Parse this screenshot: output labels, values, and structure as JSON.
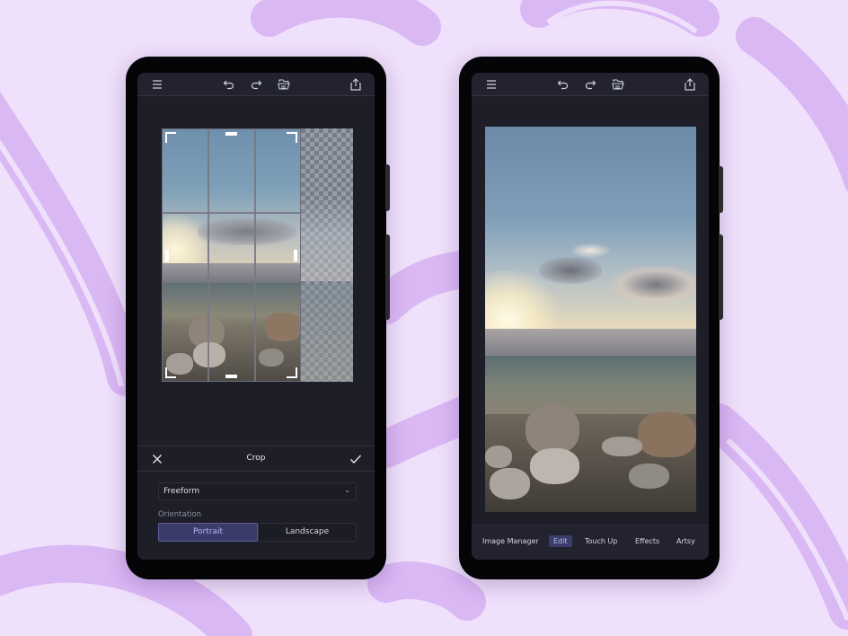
{
  "colors": {
    "background": "#efe0fb",
    "swirl": "#dab8f4",
    "phone_body": "#050507",
    "screen_bg": "#1d1e28",
    "toolbar_bg": "#22232e",
    "accent": "#3b3c6b",
    "accent_text": "#b5b8ee"
  },
  "left_phone": {
    "toolbar": {
      "icons": [
        "menu-icon",
        "undo-icon",
        "redo-icon",
        "open-folder-icon",
        "share-icon"
      ]
    },
    "crop_panel": {
      "title": "Crop",
      "cancel_icon": "close-icon",
      "confirm_icon": "check-icon",
      "aspect_select": {
        "value": "Freeform"
      },
      "orientation_label": "Orientation",
      "orientation_options": [
        {
          "label": "Portrait",
          "selected": true
        },
        {
          "label": "Landscape",
          "selected": false
        }
      ]
    },
    "crop_grid": {
      "rows": 3,
      "cols": 3
    }
  },
  "right_phone": {
    "toolbar": {
      "icons": [
        "menu-icon",
        "undo-icon",
        "redo-icon",
        "open-folder-icon",
        "share-icon"
      ]
    },
    "bottom_nav": [
      {
        "label": "Image Manager",
        "active": false
      },
      {
        "label": "Edit",
        "active": true
      },
      {
        "label": "Touch Up",
        "active": false
      },
      {
        "label": "Effects",
        "active": false
      },
      {
        "label": "Artsy",
        "active": false
      }
    ]
  }
}
